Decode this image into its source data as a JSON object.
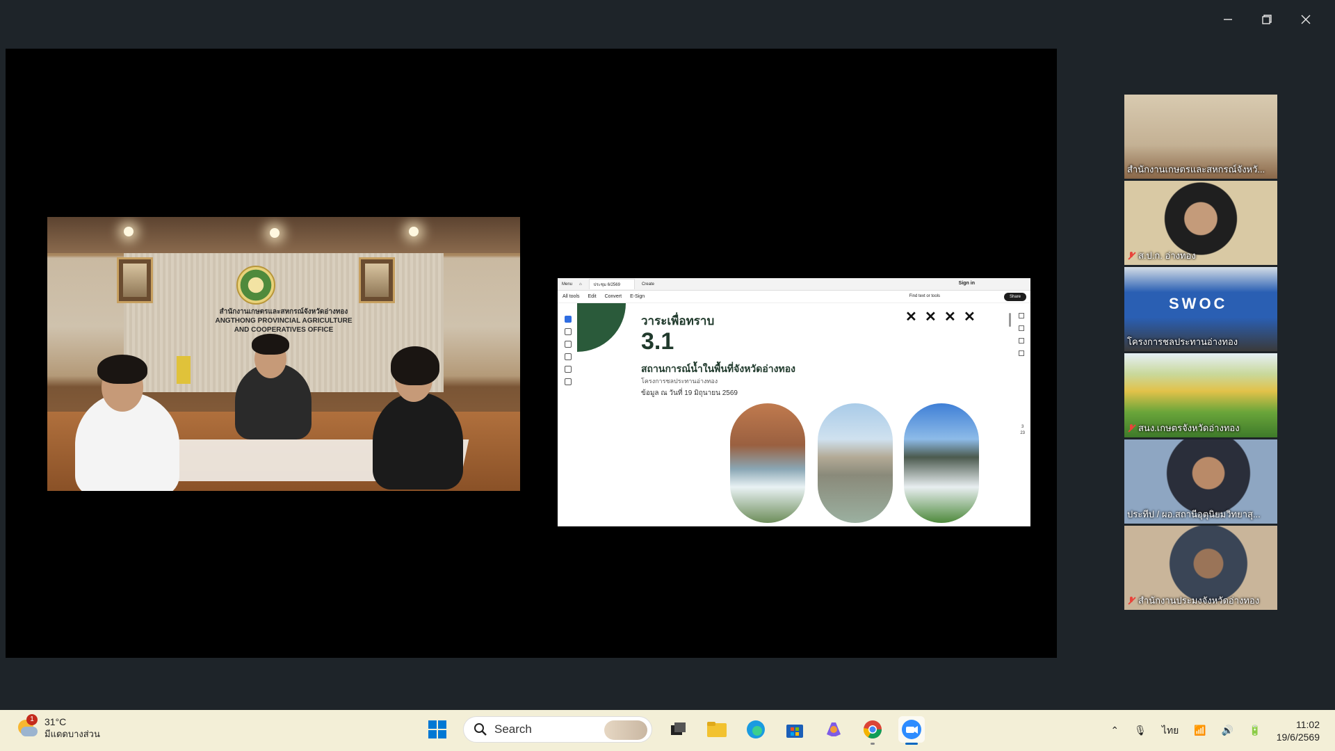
{
  "window": {
    "minimize_icon": "minimize-icon",
    "restore_icon": "restore-icon",
    "close_icon": "close-icon"
  },
  "slide": {
    "tab_title": "ประชุม 6/2569",
    "menu_label": "Menu",
    "create_label": "Create",
    "signin": "Sign in",
    "toolbar": [
      "All tools",
      "Edit",
      "Convert",
      "E-Sign"
    ],
    "find_label": "Find text or tools",
    "share_label": "Share",
    "heading": "วาระเพื่อทราบ",
    "number": "3.1",
    "subtitle": "สถานการณ์น้ำในพื้นที่จังหวัดอ่างทอง",
    "subtitle2": "โครงการชลประทานอ่างทอง",
    "date": "ข้อมูล ณ วันที่  19 มิถุนายน 2569",
    "page_num": "3",
    "page_total": "23"
  },
  "main_video": {
    "sign_th": "สำนักงานเกษตรและสหกรณ์จังหวัดอ่างทอง",
    "sign_en1": "ANGTHONG PROVINCIAL AGRICULTURE",
    "sign_en2": "AND COOPERATIVES OFFICE"
  },
  "gallery": [
    {
      "name": "สำนักงานเกษตรและสหกรณ์จังหวั...",
      "muted": false
    },
    {
      "name": "ส.ป.ก. อ่างทอง",
      "muted": true
    },
    {
      "name": "โครงการชลประทานอ่างทอง",
      "muted": false,
      "active": true,
      "sign": "SWOC"
    },
    {
      "name": "สนง.เกษตรจังหวัดอ่างทอง",
      "muted": true
    },
    {
      "name": "ประทีป / ผอ.สถานีอุตุนิยมวิทยาสุ...",
      "muted": false
    },
    {
      "name": "สำนักงานประมงจังหวัดอ่างทอง",
      "muted": true
    }
  ],
  "taskbar": {
    "weather_temp": "31°C",
    "weather_desc": "มีแดดบางส่วน",
    "weather_badge": "1",
    "search_label": "Search",
    "apps": [
      "windows-start-icon",
      "file-explorer-icon",
      "edge-icon",
      "store-icon",
      "copilot-icon",
      "chrome-icon",
      "zoom-icon"
    ],
    "lang": "ไทย",
    "time": "11:02",
    "date": "19/6/2569"
  },
  "colors": {
    "stage": "#000000",
    "active_tile": "#3cd07a",
    "taskbar": "#f3efd7",
    "slide_green": "#203a2c"
  }
}
